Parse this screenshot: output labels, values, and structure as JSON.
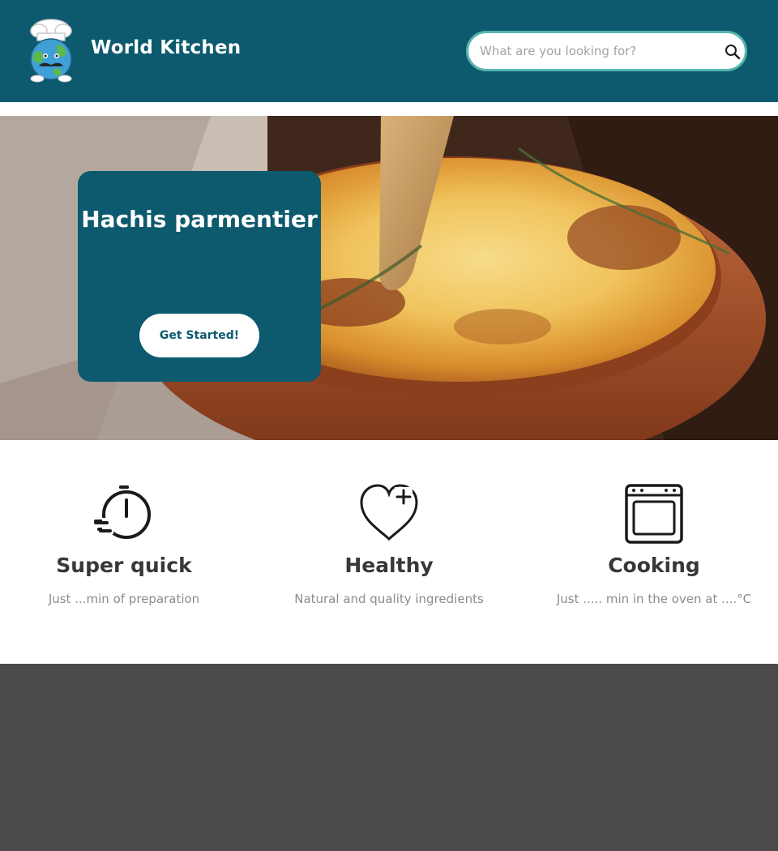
{
  "header": {
    "brand": "World Kitchen",
    "logo_icon": "chef-globe-logo",
    "background_color": "#0d5a6e"
  },
  "search": {
    "placeholder": "What are you looking for?",
    "value": "",
    "icon": "search-icon",
    "border_color": "#56b5ad"
  },
  "hero": {
    "title": "Hachis parmentier",
    "cta_label": "Get Started!",
    "image": "hachis-parmentier-dish-photo"
  },
  "features": [
    {
      "icon": "stopwatch-icon",
      "title": "Super quick",
      "description": "Just ...min of preparation"
    },
    {
      "icon": "heart-plus-icon",
      "title": "Healthy",
      "description": "Natural and quality ingredients"
    },
    {
      "icon": "oven-icon",
      "title": "Cooking",
      "description": "Just ..... min in the oven at ....°C"
    }
  ],
  "colors": {
    "primary": "#0d5a6e",
    "accent": "#56b5ad",
    "footer": "#4a4a4a"
  }
}
